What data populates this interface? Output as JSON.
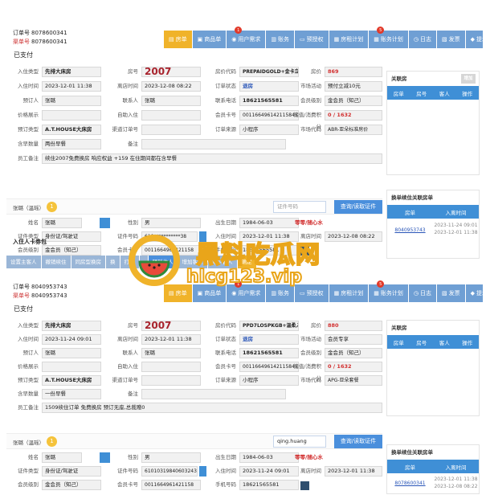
{
  "toolbar_items": [
    {
      "label": "房单",
      "icon": "document-icon",
      "style": "yellow",
      "badge": ""
    },
    {
      "label": "商品单",
      "icon": "cart-icon",
      "style": "blue",
      "badge": ""
    },
    {
      "label": "用户需求",
      "icon": "user-icon",
      "style": "blue",
      "badge": "1"
    },
    {
      "label": "账务",
      "icon": "ledger-icon",
      "style": "blue",
      "badge": ""
    },
    {
      "label": "预授权",
      "icon": "card-icon",
      "style": "blue",
      "badge": ""
    },
    {
      "label": "房租计划",
      "icon": "calendar-icon",
      "style": "blue",
      "badge": ""
    },
    {
      "label": "账务计划",
      "icon": "calendar-icon",
      "style": "blue",
      "badge": "5"
    },
    {
      "label": "日志",
      "icon": "clock-icon",
      "style": "blue",
      "badge": ""
    },
    {
      "label": "发票",
      "icon": "invoice-icon",
      "style": "blue",
      "badge": ""
    },
    {
      "label": "提示",
      "icon": "pin-icon",
      "style": "blue",
      "badge": ""
    }
  ],
  "labels": {
    "order_no": "订单号",
    "source_no": "渠单号",
    "checkin_type": "入住类型",
    "room_no": "房号",
    "rate_code": "房价代码",
    "room_price": "房价",
    "checkin_time": "入住时间",
    "checkout_time": "离店时间",
    "order_status": "订单状态",
    "market_activity": "市场活动",
    "booker": "预订人",
    "contact": "联系人",
    "contact_phone": "联系电话",
    "member_level": "会员级别",
    "price_display": "价格展示",
    "auto_checkin": "自助入住",
    "member_card": "会员卡号",
    "points": "储值/消费积分",
    "booking_type": "预订类型",
    "channel_order": "渠道订单号",
    "order_source": "订单来源",
    "market_code": "市场代码",
    "breakfast": "含早数量",
    "remark": "备注",
    "staff_remark": "员工备注",
    "guest_name_lbl": "姓名",
    "gender": "性别",
    "birth": "出生日期",
    "id_type": "证件类型",
    "id_no": "证件号码",
    "member_card2": "会员卡号",
    "phone": "手机号码",
    "query_btn": "查询/读取证件",
    "id_input_placeholder": "证件号码",
    "related_rooms": "关联房",
    "related_btn": "增加",
    "room_col": "房单",
    "roomno_col": "房号",
    "guest_col": "客人",
    "op_col": "操作",
    "swap_title": "换单续住关联房单",
    "checkin_col": "入离时间",
    "guest_card_title": "入住人卡劵包",
    "tag_text": "零零/随心水",
    "tab_star": "★"
  },
  "orders": [
    {
      "order_no": "8078600341",
      "source_no": "8078600341",
      "status": "已支付",
      "checkin_type": "先排大床房",
      "room_no": "2007",
      "rate_code": "PREPAIDGOLD+金卡立",
      "room_price": "869",
      "checkin_time": "2023-12-01 11:38",
      "checkout_time": "2023-12-08 08:22",
      "order_status": "退房",
      "market_activity": "预付立减10元",
      "booker": "张璐",
      "contact": "张璐",
      "contact_phone": "18621565581",
      "member_level": "金会员（知己）",
      "price_display": "",
      "auto_checkin": "",
      "member_card": "0011664961421158451",
      "points": "0 / 1632",
      "booking_type": "A.T.HOUSE大床房",
      "channel_order": "",
      "order_source": "小程序",
      "market_code": "ABR-亚朵标准房价",
      "breakfast": "两份早餐",
      "remark": "",
      "staff_remark": "续住2007免费换房 响应权益 +159 在住期间都在含早餐",
      "guest_tab": "张璐（温瑶）",
      "guest_tab_badge": "1",
      "search_value": "",
      "guest_name": "张璐",
      "gender": "男",
      "birth": "1984-06-03",
      "id_type": "身份证/驾驶证",
      "id_no": "610***********38",
      "guest_checkin": "2023-12-01 11:38",
      "guest_checkout": "2023-12-08 08:22",
      "guest_member_level": "金会员（知己）",
      "guest_member_card": "0011664961421158",
      "phone": "18621565581",
      "related": [],
      "swap": [
        {
          "order": "8040953743",
          "time_in": "2023-11-24 09:01",
          "time_out": "2023-12-01 11:38"
        }
      ],
      "actions": [
        {
          "label": "设置主客人",
          "style": "gray"
        },
        {
          "label": "撤销续住",
          "style": "gray"
        },
        {
          "label": "同房型换房",
          "style": "gray"
        },
        {
          "label": "换",
          "style": "gray"
        },
        {
          "label": "打印",
          "style": "gray"
        },
        {
          "label": "",
          "style": "gray"
        },
        {
          "label": "预到住人",
          "style": "blue"
        },
        {
          "label": "增加客人",
          "style": "gray"
        },
        {
          "label": "减少客人",
          "style": "gray"
        },
        {
          "label": "确定",
          "style": "yellow"
        }
      ]
    },
    {
      "order_no": "8040953743",
      "source_no": "8040953743",
      "status": "已支付",
      "checkin_type": "先排大床房",
      "room_no": "2007",
      "rate_code": "PPD7LOSPKGB+温柔入",
      "room_price": "880",
      "checkin_time": "2023-11-24 09:01",
      "checkout_time": "2023-12-01 11:38",
      "order_status": "退房",
      "market_activity": "会员专享",
      "booker": "张璐",
      "contact": "张璐",
      "contact_phone": "18621565581",
      "member_level": "金会员（知己）",
      "price_display": "",
      "auto_checkin": "",
      "member_card": "0011664961421158451",
      "points": "0 / 1632",
      "booking_type": "A.T.HOUSE大床房",
      "channel_order": "",
      "order_source": "小程序",
      "market_code": "APG-亚朵套餐",
      "breakfast": "一份早餐",
      "remark": "",
      "staff_remark": "1509续住订单 免费换房 预订无座,总裁赠0",
      "guest_tab": "张璐（温瑶）",
      "guest_tab_badge": "1",
      "search_value": "qing.huang",
      "guest_name": "张璐",
      "gender": "男",
      "birth": "1984-06-03",
      "id_type": "身份证/驾驶证",
      "id_no": "610103198406032438",
      "guest_checkin": "2023-11-24 09:01",
      "guest_checkout": "2023-12-01 11:38",
      "guest_member_level": "金会员（知己）",
      "guest_member_card": "0011664961421158",
      "phone": "18621565581",
      "related": [],
      "swap": [
        {
          "order": "8078600341",
          "time_in": "2023-12-01 11:38",
          "time_out": "2023-12-08 08:22"
        }
      ],
      "actions": []
    }
  ],
  "watermark": {
    "line1": "黑料吃瓜网",
    "line2": "hlcg123.vip"
  },
  "colors": {
    "accent_blue": "#3f8fd6",
    "toolbar_blue": "#6f9fd4",
    "yellow": "#f0b32a",
    "red": "#d23030",
    "watermark_orange": "#e9a51a"
  }
}
